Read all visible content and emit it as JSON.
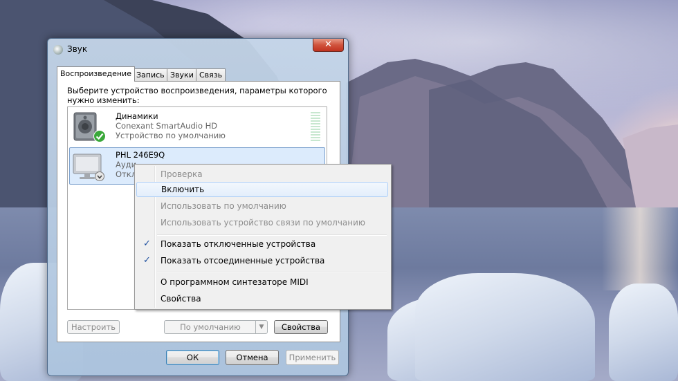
{
  "window": {
    "title": "Звук",
    "close_label": "✕"
  },
  "tabs": [
    {
      "label": "Воспроизведение",
      "active": true
    },
    {
      "label": "Запись",
      "active": false
    },
    {
      "label": "Звуки",
      "active": false
    },
    {
      "label": "Связь",
      "active": false
    }
  ],
  "playback": {
    "instruction": "Выберите устройство воспроизведения, параметры которого нужно изменить:",
    "devices": [
      {
        "name": "Динамики",
        "line2": "Conexant SmartAudio HD",
        "line3": "Устройство по умолчанию",
        "icon": "speaker-icon",
        "status": "default",
        "selected": false
      },
      {
        "name": "PHL 246E9Q",
        "line2": "Ауди",
        "line3": "Откл",
        "icon": "monitor-icon",
        "status": "disabled",
        "selected": true
      }
    ],
    "configure_label": "Настроить",
    "set_default_label": "По умолчанию",
    "properties_label": "Свойства"
  },
  "dialog_buttons": {
    "ok": "ОК",
    "cancel": "Отмена",
    "apply": "Применить"
  },
  "context_menu": {
    "items": [
      {
        "label": "Проверка",
        "disabled": true
      },
      {
        "label": "Включить",
        "disabled": false,
        "hover": true
      },
      {
        "label": "Использовать по умолчанию",
        "disabled": true
      },
      {
        "label": "Использовать устройство связи по умолчанию",
        "disabled": true
      },
      {
        "label": "Показать отключенные устройства",
        "checked": true
      },
      {
        "label": "Показать отсоединенные устройства",
        "checked": true
      },
      {
        "label": "О программном синтезаторе MIDI"
      },
      {
        "label": "Свойства"
      }
    ],
    "check_glyph": "✓"
  }
}
